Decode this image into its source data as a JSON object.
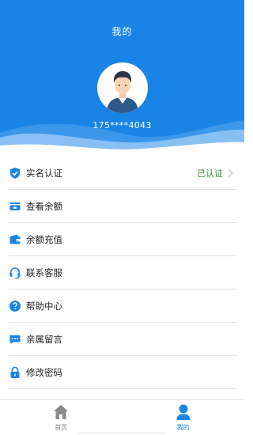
{
  "header": {
    "title": "我的",
    "phone": "175****4043"
  },
  "colors": {
    "brand": "#1a84e6",
    "verified": "#2f8a2f",
    "tab_inactive": "#8a8a8a"
  },
  "menu": [
    {
      "label": "实名认证",
      "icon": "shield-check-icon",
      "status": "已认证"
    },
    {
      "label": "查看余额",
      "icon": "wallet-card-icon"
    },
    {
      "label": "余额充值",
      "icon": "wallet-icon"
    },
    {
      "label": "联系客服",
      "icon": "headset-icon"
    },
    {
      "label": "帮助中心",
      "icon": "question-circle-icon"
    },
    {
      "label": "亲属留言",
      "icon": "chat-bubble-icon"
    },
    {
      "label": "修改密码",
      "icon": "lock-icon"
    }
  ],
  "tabbar": {
    "home": {
      "label": "首页",
      "icon": "home-icon"
    },
    "mine": {
      "label": "我的",
      "icon": "user-icon",
      "active": true
    }
  }
}
